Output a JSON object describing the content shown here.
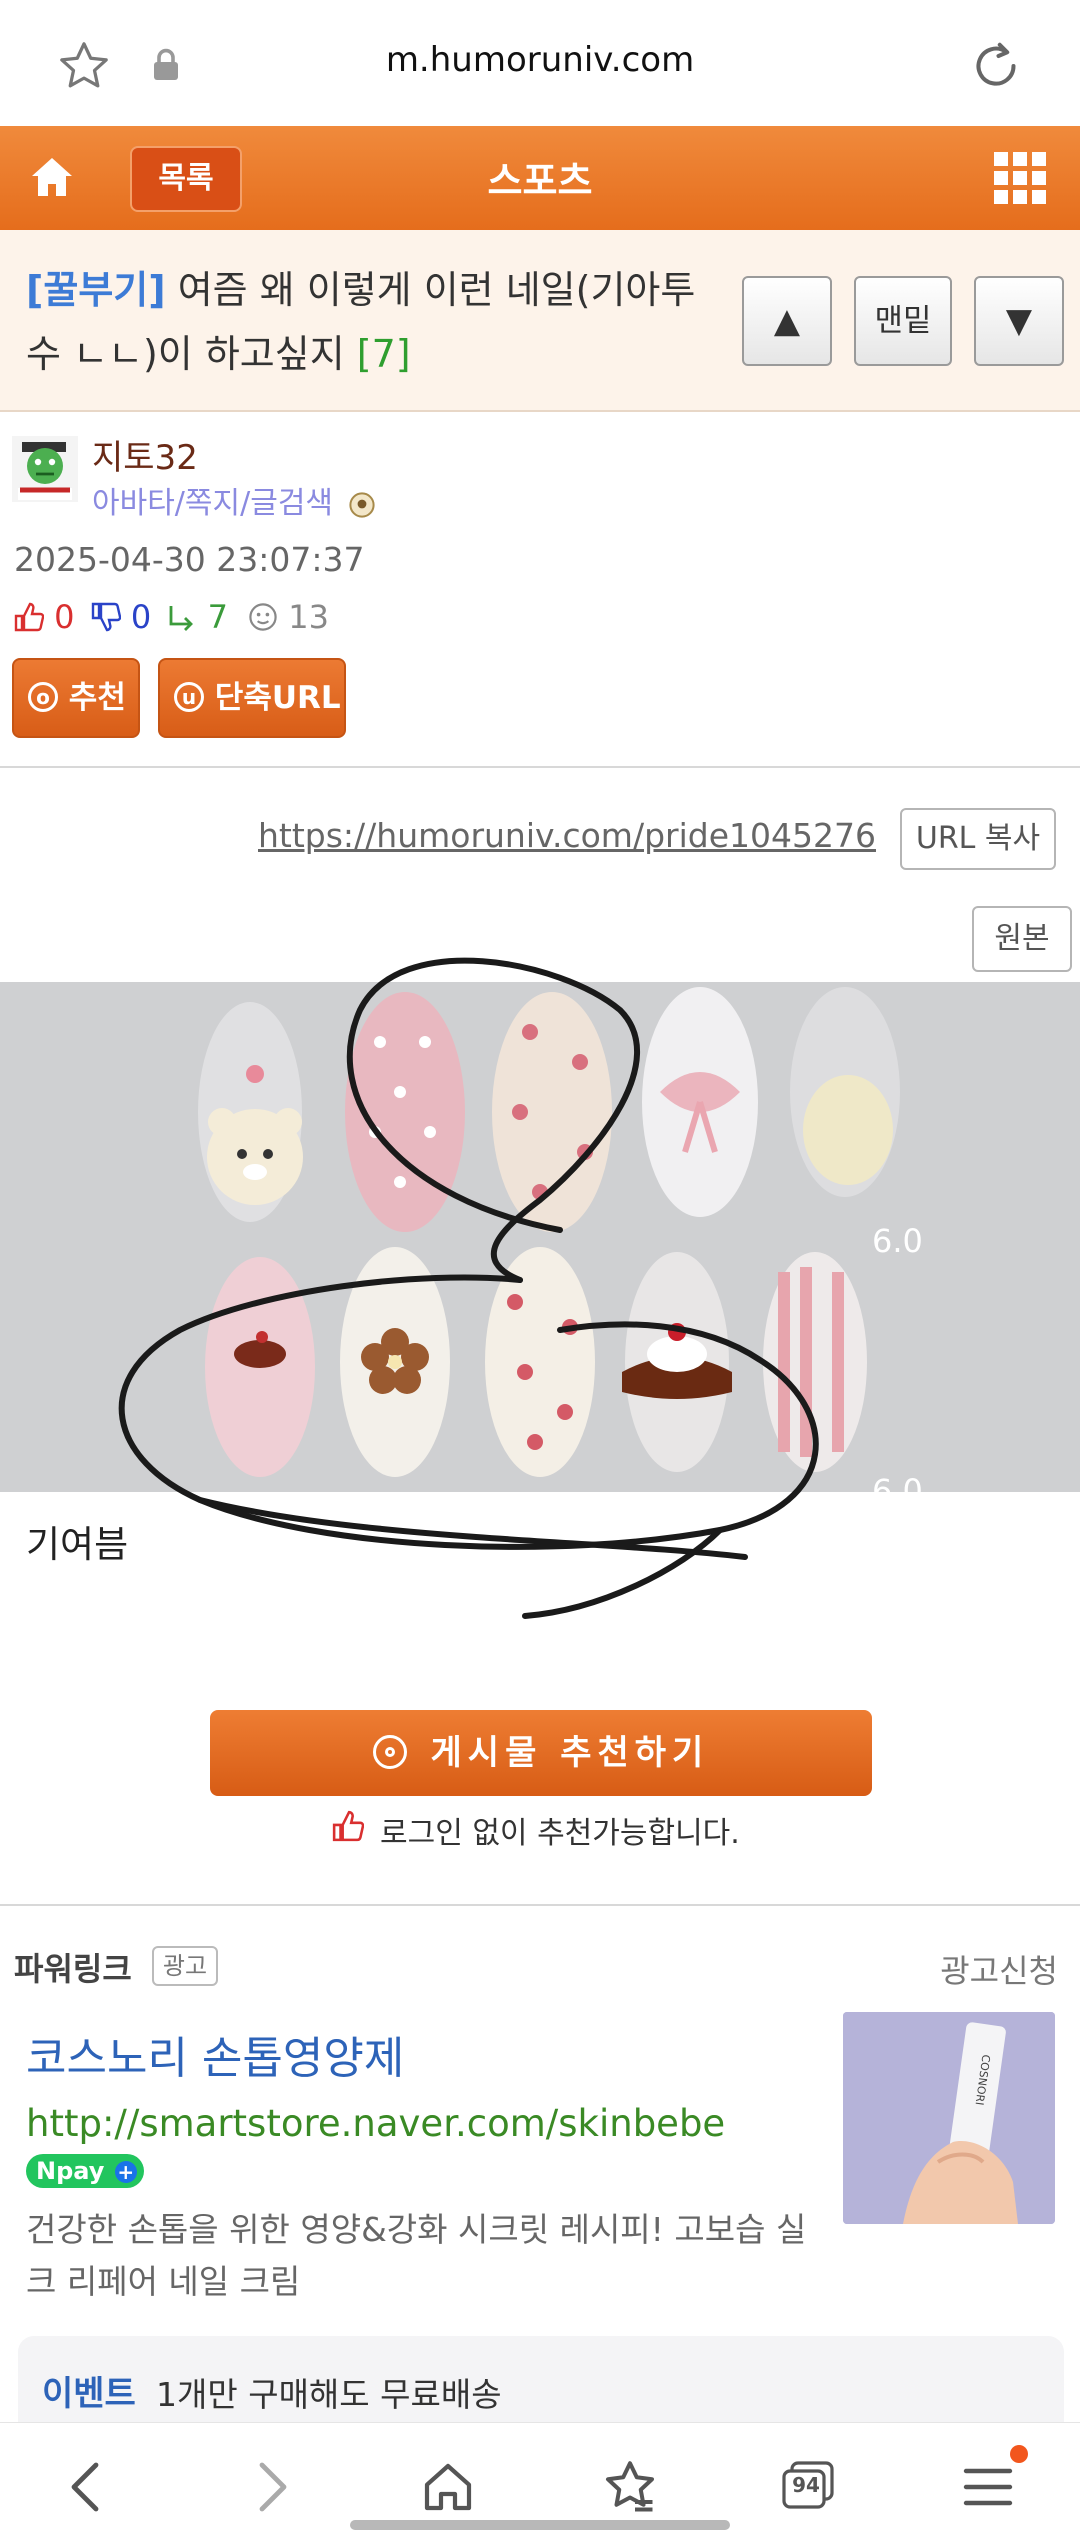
{
  "browser": {
    "url": "m.humoruniv.com",
    "icons": [
      "star-icon",
      "lock-icon",
      "refresh-icon"
    ]
  },
  "header": {
    "list_label": "목록",
    "title": "스포츠",
    "icons": [
      "home-icon",
      "grid-menu-icon"
    ]
  },
  "post": {
    "category": "[꿀부기]",
    "title": "여즘 왜 이렇게 이런 네일(기아투수 ㄴㄴ)이 하고싶지",
    "comment_count": "[7]",
    "nav": {
      "up_label": "▲",
      "bottom_label": "맨밑",
      "down_label": "▼"
    }
  },
  "author": {
    "name": "지토32",
    "links": "아바타/쪽지/글검색",
    "date": "2025-04-30 23:07:37",
    "likes": "0",
    "dislikes": "0",
    "comments": "7",
    "views": "13"
  },
  "actions": {
    "recommend": "추천",
    "short_url": "단축URL",
    "recommend_icon_letter": "o",
    "short_url_icon_letter": "u"
  },
  "content": {
    "link": "https://humoruniv.com/pride1045276",
    "copy_url": "URL 복사",
    "original": "원본",
    "image_label_1": "6.0",
    "image_label_2": "6.0",
    "caption": "기여븜"
  },
  "recommend_section": {
    "button": "게시물 추천하기",
    "note": "로그인 없이 추천가능합니다."
  },
  "ad": {
    "section_label": "파워링크",
    "badge": "광고",
    "apply": "광고신청",
    "title": "코스노리 손톱영양제",
    "url": "http://smartstore.naver.com/skinbebe",
    "npay": "Npay",
    "description": "건강한 손톱을 위한 영양&강화 시크릿 레시피! 고보습 실크 리페어 네일 크림",
    "product_text": "COSNORI",
    "event_label": "이벤트",
    "event_text": "1개만 구매해도 무료배송"
  },
  "bottom_nav": {
    "tabs_count": "94",
    "icons": [
      "back-icon",
      "forward-icon",
      "home-icon",
      "bookmarks-icon",
      "tabs-icon",
      "menu-icon"
    ]
  },
  "colors": {
    "brand_orange": "#e56d1c",
    "title_bg": "#fdf3ea",
    "link_blue": "#2d63b8",
    "ad_green": "#3a8a25"
  }
}
